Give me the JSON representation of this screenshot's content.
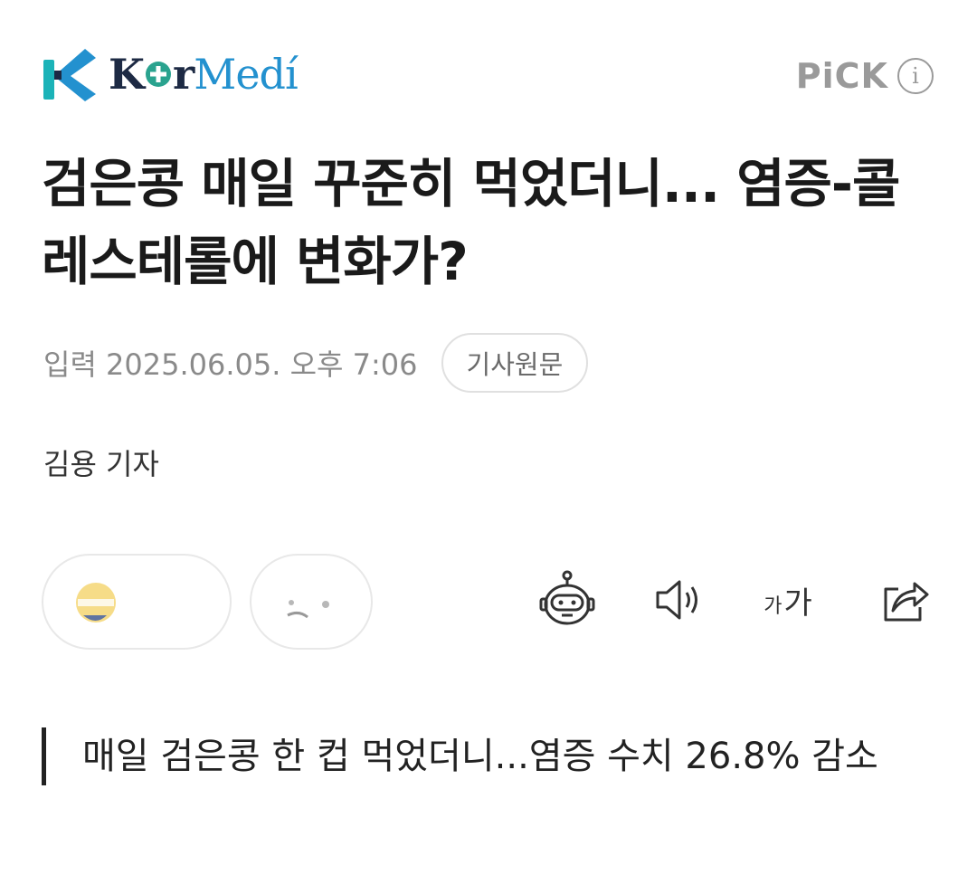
{
  "header": {
    "logo": {
      "text_k": "K",
      "text_r": "r",
      "text_medi": "Medí",
      "brand_colors": {
        "navy": "#1d2a44",
        "blue": "#2391cf",
        "teal": "#1bb3b8"
      },
      "logo_icon": "kormedi-logo-icon"
    },
    "pick_label": "PiCK",
    "info_icon": "i"
  },
  "article": {
    "headline": "검은콩 매일 꾸준히 먹었더니... 염증-콜레스테롤에 변화가?",
    "meta": {
      "date": "입력 2025.06.05. 오후 7:06",
      "original_button": "기사원문"
    },
    "author": "김용 기자",
    "quote": "매일 검은콩 한 컵 먹었더니...염증 수치 26.8% 감소"
  },
  "toolbar": {
    "icons": [
      "ai-bot-icon",
      "speaker-icon",
      "font-size-icon",
      "share-icon"
    ],
    "font_small": "가",
    "font_large": "가"
  }
}
